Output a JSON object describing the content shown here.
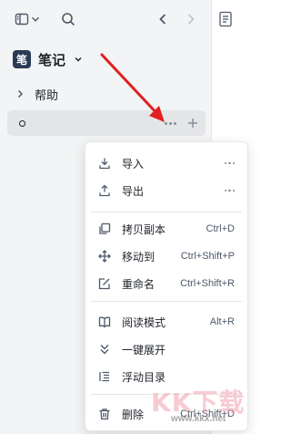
{
  "notebook": {
    "badge": "笔",
    "title": "笔记"
  },
  "tree": {
    "help_label": "帮助",
    "active_label": ""
  },
  "menu": {
    "items": [
      {
        "label": "导入",
        "shortcut": "",
        "icon": "import-icon"
      },
      {
        "label": "导出",
        "shortcut": "",
        "icon": "export-icon"
      },
      {
        "label": "拷贝副本",
        "shortcut": "Ctrl+D",
        "icon": "copy-icon"
      },
      {
        "label": "移动到",
        "shortcut": "Ctrl+Shift+P",
        "icon": "move-icon"
      },
      {
        "label": "重命名",
        "shortcut": "Ctrl+Shift+R",
        "icon": "rename-icon"
      },
      {
        "label": "阅读模式",
        "shortcut": "Alt+R",
        "icon": "book-icon"
      },
      {
        "label": "一键展开",
        "shortcut": "",
        "icon": "expand-all-icon"
      },
      {
        "label": "浮动目录",
        "shortcut": "",
        "icon": "toc-icon"
      },
      {
        "label": "删除",
        "shortcut": "Ctrl+Shift+D",
        "icon": "trash-icon"
      }
    ]
  },
  "watermark": {
    "text": "KK下载",
    "url": "www.kkx.net"
  },
  "colors": {
    "sidebar_bg": "#f3f4f5",
    "active_row": "#e4e5e7",
    "arrow": "#e02020",
    "badge": "#2b3a55"
  }
}
